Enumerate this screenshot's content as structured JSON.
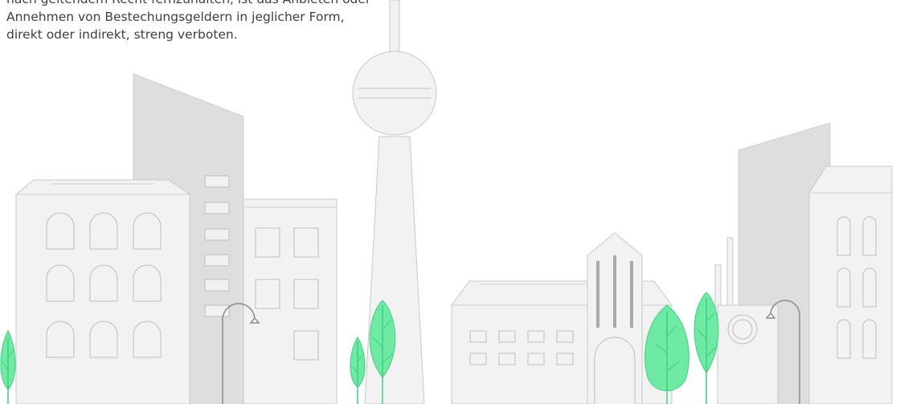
{
  "intro": {
    "lines": [
      "nach geltendem Recht fernzuhalten, ist das Anbieten oder",
      "Annehmen von Bestechungsgeldern in jeglicher Form,",
      "direkt oder indirekt, streng verboten."
    ]
  },
  "illustration": {
    "subject": "city-skyline",
    "colors": {
      "building_fill": "#f1f1f1",
      "building_shadow": "#dedede",
      "outline": "#c8c8c8",
      "tree_fill": "#6eeaa4",
      "tree_outline": "#3fcf7f",
      "lamp_post": "#8a8a8a",
      "church_stripes": "#a9a9a9"
    }
  }
}
